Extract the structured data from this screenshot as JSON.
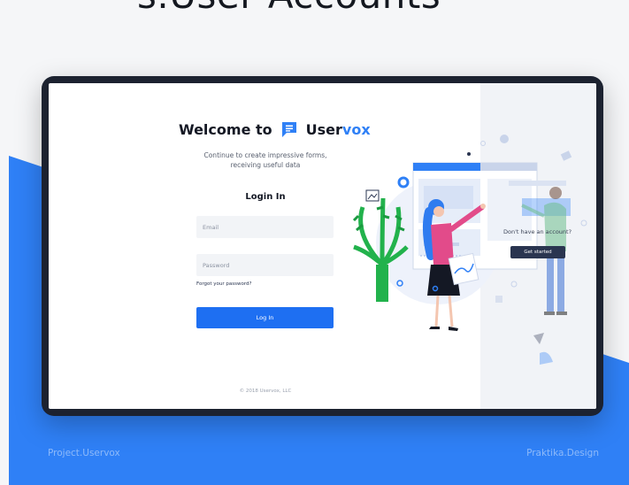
{
  "header": {
    "title": "s.User Accounts"
  },
  "login": {
    "welcome": "Welcome to",
    "brand_main": "User",
    "brand_accent": "vox",
    "tagline_line1": "Continue to create impressive forms,",
    "tagline_line2": "receiving useful data",
    "title": "Login In",
    "email_placeholder": "Email",
    "password_placeholder": "Password",
    "forgot": "Forgot your password?",
    "button": "Log In",
    "copyright": "© 2018 Uservox, LLC"
  },
  "signup": {
    "prompt": "Don't have an account?",
    "button": "Get started"
  },
  "footer": {
    "left": "Project.Uservox",
    "right": "Praktika.Design"
  },
  "colors": {
    "accent": "#2f80f6",
    "button": "#1e6ff2",
    "dark": "#2a3550",
    "plant": "#22b24c",
    "figure_hair": "#2f7cf0",
    "figure_top": "#e24b8a"
  }
}
